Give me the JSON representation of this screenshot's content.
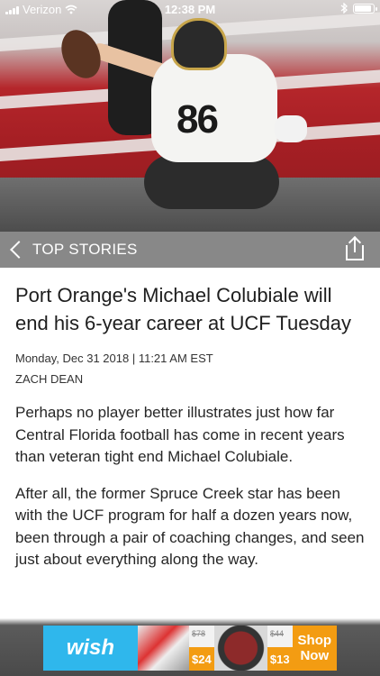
{
  "status_bar": {
    "carrier": "Verizon",
    "time": "12:38 PM",
    "icons": [
      "signal-icon",
      "wifi-icon",
      "bluetooth-icon",
      "battery-icon"
    ]
  },
  "nav": {
    "back_label": "TOP STORIES",
    "icons": [
      "chevron-left-icon",
      "share-icon"
    ]
  },
  "article": {
    "headline": "Port Orange's Michael Colubiale will end his 6-year career at UCF Tuesday",
    "dateline": "Monday, Dec 31 2018 | 11:21 AM EST",
    "byline": "ZACH DEAN",
    "paragraphs": [
      "Perhaps no player better illustrates just how far Central Florida football has come in recent years than veteran tight end Michael Colubiale.",
      "After all, the former Spruce Creek star has been with the UCF program for half a dozen years now, been through a pair of coaching changes, and seen just about everything along the way."
    ]
  },
  "hero": {
    "jersey_number": "86"
  },
  "ad": {
    "brand": "wish",
    "offers": [
      {
        "old_price": "$78",
        "price": "$24"
      },
      {
        "old_price": "$44",
        "price": "$13"
      }
    ],
    "cta_line1": "Shop",
    "cta_line2": "Now"
  },
  "colors": {
    "nav_bar": "#787878",
    "wish_blue": "#2fb7ec",
    "cta_orange": "#f39c12"
  }
}
